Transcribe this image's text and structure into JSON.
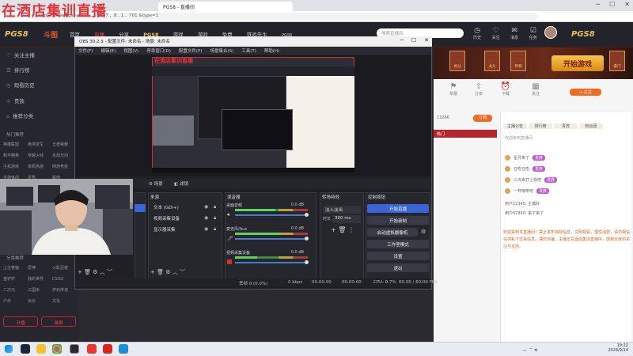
{
  "stream_overlay": {
    "title": "在酒店集训直播"
  },
  "browser": {
    "tab_title": "PGS8 - 直播间",
    "address_partial": "https://www.pgs8.com/...",
    "address_tail": "...8c87... 8...1... 701  &type=1"
  },
  "site": {
    "logo": "PGS8",
    "logo_secondary": "斗图",
    "nav": [
      "首页",
      "直播",
      "分享",
      "PGS8",
      "游戏",
      "游戏",
      "免费",
      "铁鸡先生",
      "PGS8"
    ],
    "search_placeholder": "搜索直播间",
    "header_icons": [
      "历史",
      "关注",
      "消息",
      "任务",
      "下载"
    ],
    "right_logo": "PGS8",
    "play_button": "开始游戏"
  },
  "left_sidebar": {
    "items": [
      {
        "icon": "♡",
        "label": "关注主播"
      },
      {
        "icon": "☰",
        "label": "排行榜"
      },
      {
        "icon": "◷",
        "label": "观看历史"
      },
      {
        "icon": "♕",
        "label": "贵族"
      },
      {
        "icon": "⌂",
        "label": "推荐分类"
      }
    ],
    "section_label": "热门推荐",
    "grid": [
      "英雄联盟",
      "绝地求生",
      "王者荣耀",
      "和平精英",
      "穿越火线",
      "永劫无间",
      "主机游戏",
      "单机热游",
      "网游竞技",
      "手游休闲",
      "星秀",
      "颜值"
    ],
    "section_label2": "分类推荐",
    "grid2": [
      "上古卷轴",
      "原神",
      "火影忍者",
      "金铲铲",
      "我的世界",
      "CSGO",
      "二次元",
      "三国杀",
      "炉石传说",
      "户外",
      "派对",
      "文化"
    ],
    "btn_open": "开播",
    "btn_rec": "录屏"
  },
  "obs": {
    "title": "OBS 30.2.3 - 配置文件: 未命名 - 场景: 未命名",
    "menu": [
      "文件(F)",
      "编辑(E)",
      "视图(V)",
      "停靠窗口(D)",
      "配置文件(P)",
      "场景集合(S)",
      "工具(T)",
      "帮助(H)"
    ],
    "scene_tabs": [
      "场景",
      "滤镜"
    ],
    "docks": {
      "scenes": "场景",
      "sources": "来源",
      "mixer": "混音器",
      "transitions": "转场特效",
      "controls": "控制按钮"
    },
    "sources": [
      {
        "name": "文本 (GDI+)"
      },
      {
        "name": "视频采集设备"
      },
      {
        "name": "显示器采集"
      }
    ],
    "mixer": [
      {
        "name": "桌面音频",
        "db": "0.0 dB",
        "level": 0.55
      },
      {
        "name": "麦克风/Aux",
        "db": "0.0 dB",
        "level": 0.62
      },
      {
        "name": "视频采集设备",
        "db": "0.0 dB",
        "level": 0.3
      }
    ],
    "transition": {
      "type": "淡入淡出",
      "duration_label": "时长",
      "duration": "300 ms"
    },
    "controls": [
      "开始直播",
      "开始录制",
      "启动虚拟摄像机",
      "工作室模式",
      "设置",
      "退出"
    ],
    "status": {
      "drop": "丢帧 0 (0.0%)",
      "bitrate": "0 kbps",
      "live_time": "00:00:00",
      "rec_time": "00:00:00",
      "cpu": "CPU: 0.7%",
      "fps": "60.00 / 60.00 FPS"
    }
  },
  "right_panel": {
    "banner_badges": [
      "高分",
      "龙头",
      "神将",
      "豪门"
    ],
    "toolbar": [
      "举报",
      "分享",
      "下载",
      "关注"
    ],
    "follow_pill": "+ 关注",
    "room_pill": "订阅",
    "room_info": "13266",
    "red_strip": "热门",
    "chat_tabs": [
      "主播公告",
      "排行榜",
      "贵宾",
      "粉丝团"
    ],
    "chat_tip": "欢迎来到直播间",
    "chat_rows": [
      {
        "name": "星月来了",
        "tag": "贵族"
      },
      {
        "name": "在吃在吃",
        "tag": "贵族"
      },
      {
        "name": "三点来打上我吧",
        "tag": "贵族"
      },
      {
        "name": "一杯咖啡吧",
        "tag": "贵族"
      }
    ],
    "chat_line_1": "用户12345: 主播好",
    "chat_line_2": "用户67890: 来了来了",
    "chat_text": "欢迎来到本直播间！禁止发布违规信息，文明观看，理性消费，请勿相信任何私下交易信息，谨防诈骗。主播正在酒店集训直播中，感谢大家的关注与支持。"
  },
  "taskbar": {
    "time": "19:22",
    "date": "2024/9/14"
  }
}
